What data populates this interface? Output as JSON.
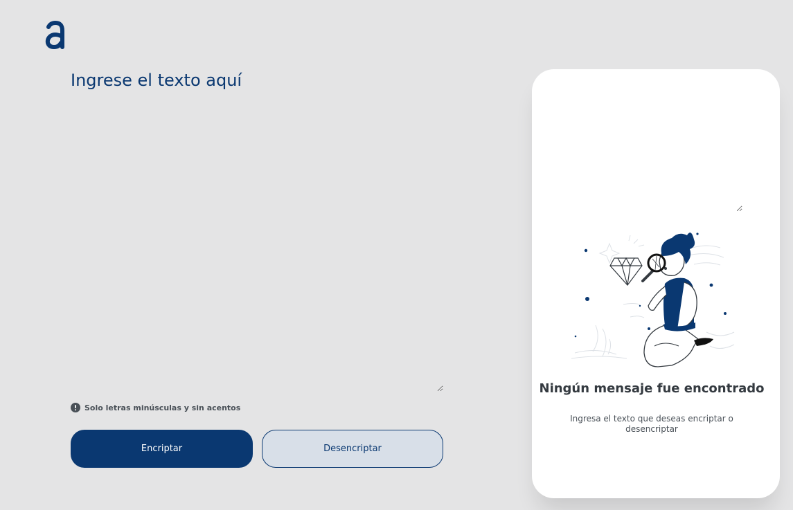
{
  "app": {
    "logo_icon": "alura-logo-icon",
    "accent_color": "#0a3871"
  },
  "input": {
    "placeholder": "Ingrese el texto aquí",
    "value": ""
  },
  "hint": {
    "icon": "exclamation-circle-icon",
    "text": "Solo letras minúsculas y sin acentos"
  },
  "actions": {
    "encrypt_label": "Encriptar",
    "decrypt_label": "Desencriptar"
  },
  "output": {
    "value": "",
    "illustration": "person-with-magnifying-glass-illustration",
    "empty_title": "Ningún mensaje fue encontrado",
    "empty_subtitle": "Ingresa el texto que deseas encriptar o desencriptar"
  }
}
